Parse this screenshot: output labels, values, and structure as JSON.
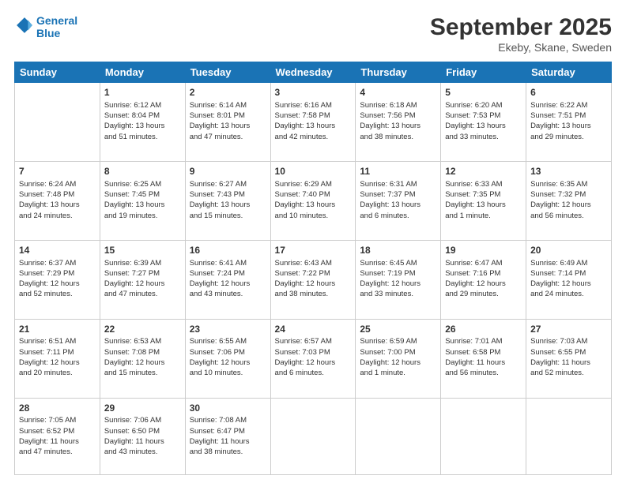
{
  "logo": {
    "line1": "General",
    "line2": "Blue"
  },
  "header": {
    "month_year": "September 2025",
    "location": "Ekeby, Skane, Sweden"
  },
  "days": [
    "Sunday",
    "Monday",
    "Tuesday",
    "Wednesday",
    "Thursday",
    "Friday",
    "Saturday"
  ],
  "weeks": [
    [
      {
        "day": "",
        "data": ""
      },
      {
        "day": "1",
        "data": "Sunrise: 6:12 AM\nSunset: 8:04 PM\nDaylight: 13 hours\nand 51 minutes."
      },
      {
        "day": "2",
        "data": "Sunrise: 6:14 AM\nSunset: 8:01 PM\nDaylight: 13 hours\nand 47 minutes."
      },
      {
        "day": "3",
        "data": "Sunrise: 6:16 AM\nSunset: 7:58 PM\nDaylight: 13 hours\nand 42 minutes."
      },
      {
        "day": "4",
        "data": "Sunrise: 6:18 AM\nSunset: 7:56 PM\nDaylight: 13 hours\nand 38 minutes."
      },
      {
        "day": "5",
        "data": "Sunrise: 6:20 AM\nSunset: 7:53 PM\nDaylight: 13 hours\nand 33 minutes."
      },
      {
        "day": "6",
        "data": "Sunrise: 6:22 AM\nSunset: 7:51 PM\nDaylight: 13 hours\nand 29 minutes."
      }
    ],
    [
      {
        "day": "7",
        "data": "Sunrise: 6:24 AM\nSunset: 7:48 PM\nDaylight: 13 hours\nand 24 minutes."
      },
      {
        "day": "8",
        "data": "Sunrise: 6:25 AM\nSunset: 7:45 PM\nDaylight: 13 hours\nand 19 minutes."
      },
      {
        "day": "9",
        "data": "Sunrise: 6:27 AM\nSunset: 7:43 PM\nDaylight: 13 hours\nand 15 minutes."
      },
      {
        "day": "10",
        "data": "Sunrise: 6:29 AM\nSunset: 7:40 PM\nDaylight: 13 hours\nand 10 minutes."
      },
      {
        "day": "11",
        "data": "Sunrise: 6:31 AM\nSunset: 7:37 PM\nDaylight: 13 hours\nand 6 minutes."
      },
      {
        "day": "12",
        "data": "Sunrise: 6:33 AM\nSunset: 7:35 PM\nDaylight: 13 hours\nand 1 minute."
      },
      {
        "day": "13",
        "data": "Sunrise: 6:35 AM\nSunset: 7:32 PM\nDaylight: 12 hours\nand 56 minutes."
      }
    ],
    [
      {
        "day": "14",
        "data": "Sunrise: 6:37 AM\nSunset: 7:29 PM\nDaylight: 12 hours\nand 52 minutes."
      },
      {
        "day": "15",
        "data": "Sunrise: 6:39 AM\nSunset: 7:27 PM\nDaylight: 12 hours\nand 47 minutes."
      },
      {
        "day": "16",
        "data": "Sunrise: 6:41 AM\nSunset: 7:24 PM\nDaylight: 12 hours\nand 43 minutes."
      },
      {
        "day": "17",
        "data": "Sunrise: 6:43 AM\nSunset: 7:22 PM\nDaylight: 12 hours\nand 38 minutes."
      },
      {
        "day": "18",
        "data": "Sunrise: 6:45 AM\nSunset: 7:19 PM\nDaylight: 12 hours\nand 33 minutes."
      },
      {
        "day": "19",
        "data": "Sunrise: 6:47 AM\nSunset: 7:16 PM\nDaylight: 12 hours\nand 29 minutes."
      },
      {
        "day": "20",
        "data": "Sunrise: 6:49 AM\nSunset: 7:14 PM\nDaylight: 12 hours\nand 24 minutes."
      }
    ],
    [
      {
        "day": "21",
        "data": "Sunrise: 6:51 AM\nSunset: 7:11 PM\nDaylight: 12 hours\nand 20 minutes."
      },
      {
        "day": "22",
        "data": "Sunrise: 6:53 AM\nSunset: 7:08 PM\nDaylight: 12 hours\nand 15 minutes."
      },
      {
        "day": "23",
        "data": "Sunrise: 6:55 AM\nSunset: 7:06 PM\nDaylight: 12 hours\nand 10 minutes."
      },
      {
        "day": "24",
        "data": "Sunrise: 6:57 AM\nSunset: 7:03 PM\nDaylight: 12 hours\nand 6 minutes."
      },
      {
        "day": "25",
        "data": "Sunrise: 6:59 AM\nSunset: 7:00 PM\nDaylight: 12 hours\nand 1 minute."
      },
      {
        "day": "26",
        "data": "Sunrise: 7:01 AM\nSunset: 6:58 PM\nDaylight: 11 hours\nand 56 minutes."
      },
      {
        "day": "27",
        "data": "Sunrise: 7:03 AM\nSunset: 6:55 PM\nDaylight: 11 hours\nand 52 minutes."
      }
    ],
    [
      {
        "day": "28",
        "data": "Sunrise: 7:05 AM\nSunset: 6:52 PM\nDaylight: 11 hours\nand 47 minutes."
      },
      {
        "day": "29",
        "data": "Sunrise: 7:06 AM\nSunset: 6:50 PM\nDaylight: 11 hours\nand 43 minutes."
      },
      {
        "day": "30",
        "data": "Sunrise: 7:08 AM\nSunset: 6:47 PM\nDaylight: 11 hours\nand 38 minutes."
      },
      {
        "day": "",
        "data": ""
      },
      {
        "day": "",
        "data": ""
      },
      {
        "day": "",
        "data": ""
      },
      {
        "day": "",
        "data": ""
      }
    ]
  ]
}
